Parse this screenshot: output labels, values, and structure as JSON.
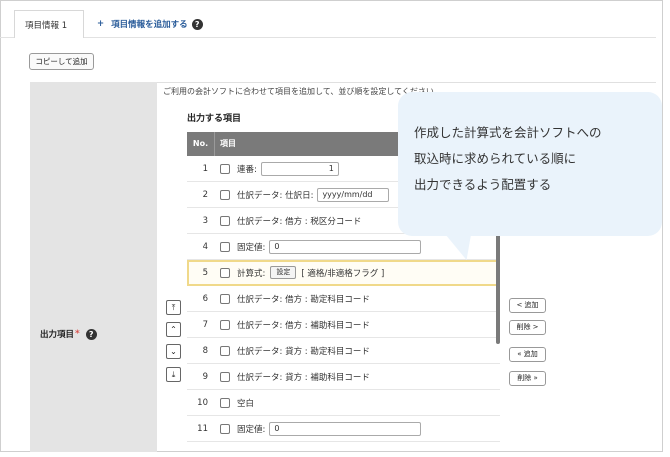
{
  "tabs": {
    "active_label": "項目情報 1",
    "add_label": "項目情報を追加する",
    "add_plus": "+"
  },
  "copy_button": "コピーして追加",
  "field_label": "出力項目",
  "required_mark": "*",
  "description": "ご利用の会計ソフトに合わせて項目を追加して、並び順を設定してください。",
  "section_title": "出力する項目",
  "table": {
    "header_no": "No.",
    "header_item": "項目",
    "rows": [
      {
        "no": "1",
        "label": "連番:",
        "input": "1"
      },
      {
        "no": "2",
        "label": "仕訳データ: 仕訳日:",
        "input": "yyyy/mm/dd"
      },
      {
        "no": "3",
        "label": "仕訳データ: 借方 : 税区分コード"
      },
      {
        "no": "4",
        "label": "固定値:",
        "input": "0"
      },
      {
        "no": "5",
        "label": "計算式:",
        "button": "設定",
        "value": "[ 適格/非適格フラグ ]"
      },
      {
        "no": "6",
        "label": "仕訳データ: 借方 : 勘定科目コード"
      },
      {
        "no": "7",
        "label": "仕訳データ: 借方 : 補助科目コード"
      },
      {
        "no": "8",
        "label": "仕訳データ: 貸方 : 勘定科目コード"
      },
      {
        "no": "9",
        "label": "仕訳データ: 貸方 : 補助科目コード"
      },
      {
        "no": "10",
        "label": "空白"
      },
      {
        "no": "11",
        "label": "固定値:",
        "input": "0"
      }
    ]
  },
  "order_buttons": {
    "top": "⤒",
    "up": "⌃",
    "down": "⌄",
    "bottom": "⤓"
  },
  "side_buttons": {
    "add": "< 追加",
    "remove": "削除 >",
    "add_all": "« 追加",
    "remove_all": "削除 »"
  },
  "callout": {
    "line1": "作成した計算式を会計ソフトへの",
    "line2": "取込時に求められている順に",
    "line3": "出力できるよう配置する"
  },
  "colors": {
    "accent": "#2a5c9a",
    "highlight": "#f0d98a",
    "header": "#7a7a7a",
    "callout": "#eaf3fb"
  }
}
